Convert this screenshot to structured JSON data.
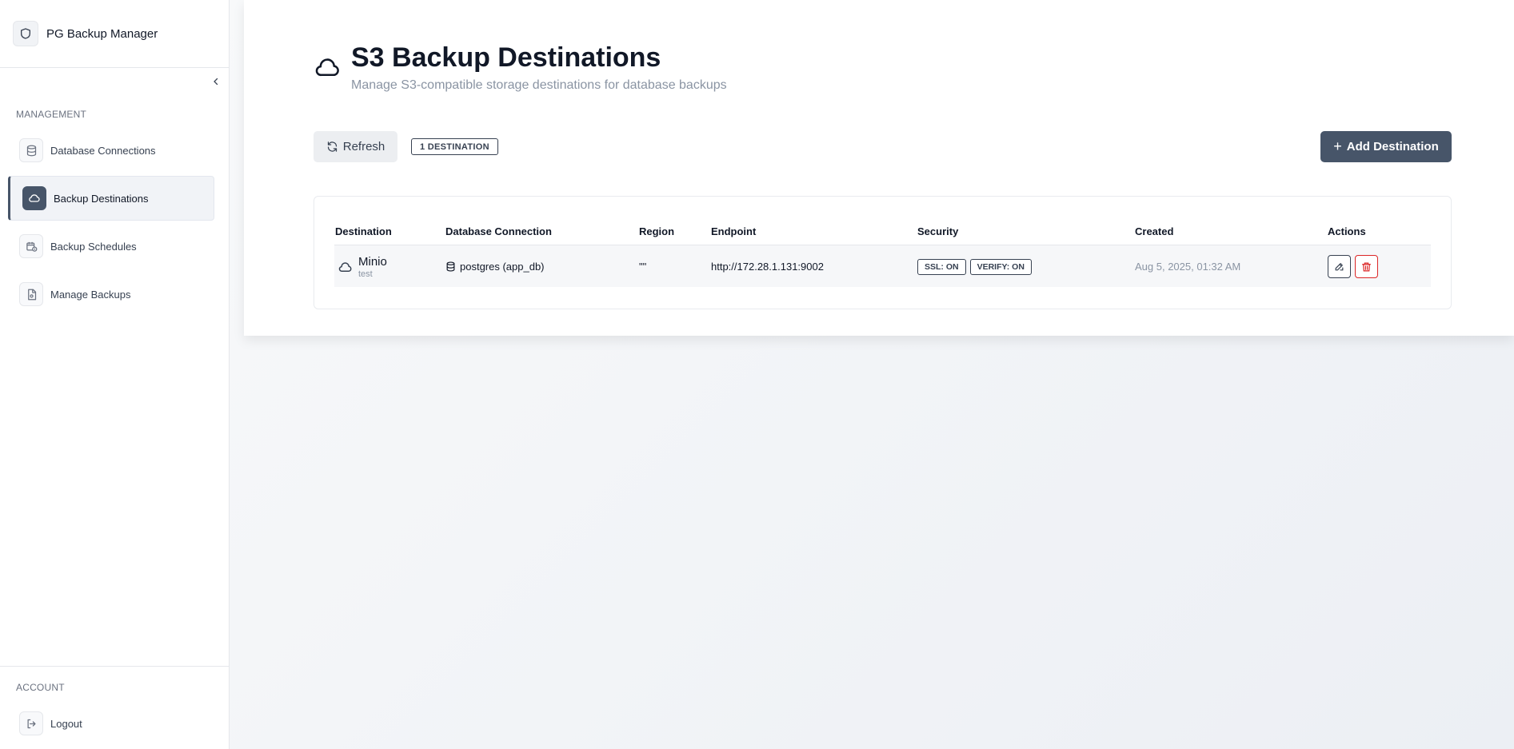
{
  "app": {
    "title": "PG Backup Manager"
  },
  "sidebar": {
    "management_label": "MANAGEMENT",
    "items": [
      {
        "label": "Database Connections",
        "icon": "database-icon",
        "active": false
      },
      {
        "label": "Backup Destinations",
        "icon": "cloud-icon",
        "active": true
      },
      {
        "label": "Backup Schedules",
        "icon": "calendar-clock-icon",
        "active": false
      },
      {
        "label": "Manage Backups",
        "icon": "file-archive-icon",
        "active": false
      }
    ],
    "account_label": "ACCOUNT",
    "logout_label": "Logout"
  },
  "page": {
    "title": "S3 Backup Destinations",
    "subtitle": "Manage S3-compatible storage destinations for database backups",
    "refresh_label": "Refresh",
    "count_badge": "1 DESTINATION",
    "add_label": "Add Destination"
  },
  "table": {
    "columns": [
      "Destination",
      "Database Connection",
      "Region",
      "Endpoint",
      "Security",
      "Created",
      "Actions"
    ],
    "rows": [
      {
        "name": "Minio",
        "description": "test",
        "connection": "postgres (app_db)",
        "region": "\"\"",
        "endpoint": "http://172.28.1.131:9002",
        "ssl": "SSL: ON",
        "verify": "VERIFY: ON",
        "created": "Aug 5, 2025, 01:32 AM"
      }
    ]
  },
  "colors": {
    "accent": "#475569",
    "danger": "#dc2626",
    "muted_text": "#8a94a3"
  }
}
